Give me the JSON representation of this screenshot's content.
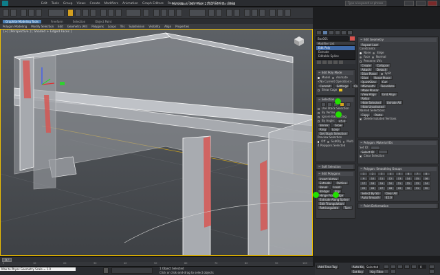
{
  "title_bar": {
    "window_title": "Autodesk 3ds Max 2012 x64     Untitled",
    "search_placeholder": "Type a keyword or phrase",
    "menus": [
      "Edit",
      "Tools",
      "Group",
      "Views",
      "Create",
      "Modifiers",
      "Animation",
      "Graph Editors",
      "Rendering",
      "Customize",
      "MAXScript",
      "Help"
    ]
  },
  "ribbon": {
    "tabs": [
      "Graphite Modeling Tools",
      "Freeform",
      "Selection",
      "Object Paint"
    ],
    "active_tab": 0,
    "subtabs": [
      "Polygon Modeling",
      "Modify Selection",
      "Edit",
      "Geometry (All)",
      "Polygons",
      "Loops",
      "Tris",
      "Subdivision",
      "Visibility",
      "Align",
      "Properties"
    ]
  },
  "viewport": {
    "label": "[+] [Perspective ] [ Shaded + Edged Faces ]",
    "border_color": "#f0c000",
    "highlight_color": "#d9534f"
  },
  "command_panel": {
    "object_name": "Box001",
    "modifier_list_label": "Modifier List",
    "stack": [
      "Edit Poly",
      "Extrude",
      "Editable Spline"
    ],
    "selected_stack_item": 0,
    "edit_poly_mode": {
      "header": "Edit Poly Mode",
      "model_label": "Model",
      "animate_label": "Animate",
      "current_op": "<No Current Operation>",
      "commit_label": "Commit",
      "settings_label": "Settings",
      "cancel_label": "Cancel",
      "show_cage_label": "Show Cage"
    },
    "selection": {
      "header": "Selection",
      "use_stack_label": "Use Stack Selection",
      "by_vertex_label": "By Vertex",
      "ignore_backfacing_label": "Ignore Backfacing",
      "by_angle_label": "By Angle:",
      "by_angle_value": "45.0",
      "shrink_label": "Shrink",
      "grow_label": "Grow",
      "ring_label": "Ring",
      "loop_label": "Loop",
      "get_stack_label": "Get Stack Selection",
      "preview_label": "Preview Selection",
      "off_label": "Off",
      "subobj_label": "SubObj",
      "multi_label": "Multi",
      "status": "4 Polygons Selected"
    },
    "soft_selection_header": "Soft Selection",
    "edit_polygons": {
      "header": "Edit Polygons",
      "insert_vertex_label": "Insert Vertex",
      "extrude_label": "Extrude",
      "outline_label": "Outline",
      "bevel_label": "Bevel",
      "inset_label": "Inset",
      "bridge_label": "Bridge",
      "flip_label": "Flip",
      "hinge_label": "Hinge From Edge",
      "extrude_spline_label": "Extrude Along Spline",
      "edit_tri_label": "Edit Triangulation",
      "retriangulate_label": "Retriangulate",
      "turn_label": "Turn"
    },
    "edit_geometry": {
      "header": "Edit Geometry",
      "repeat_last_label": "Repeat Last",
      "constraints_label": "Constraints",
      "none_label": "None",
      "edge_label": "Edge",
      "face_label": "Face",
      "normal_label": "Normal",
      "preserve_uvs_label": "Preserve UVs",
      "create_label": "Create",
      "collapse_label": "Collapse",
      "attach_label": "Attach",
      "detach_label": "Detach",
      "slice_plane_label": "Slice Plane",
      "split_label": "Split",
      "slice_label": "Slice",
      "reset_plane_label": "Reset Plane",
      "quickslice_label": "QuickSlice",
      "cut_label": "Cut",
      "msmooth_label": "MSmooth",
      "tessellate_label": "Tessellate",
      "make_planar_label": "Make Planar",
      "view_align_label": "View Align",
      "grid_align_label": "Grid Align",
      "relax_label": "Relax",
      "hide_selected_label": "Hide Selected",
      "unhide_all_label": "Unhide All",
      "hide_unselected_label": "Hide Unselected",
      "named_sel_label": "Named Selections:",
      "copy_label": "Copy",
      "paste_label": "Paste",
      "delete_isolated_label": "Delete Isolated Vertices"
    },
    "polygon_material_ids": {
      "header": "Polygon: Material IDs",
      "set_id_label": "Set ID:",
      "select_id_label": "Select ID",
      "clear_selection_label": "Clear Selection"
    },
    "smoothing_groups": {
      "header": "Polygon: Smoothing Groups",
      "numbers": [
        "1",
        "2",
        "3",
        "4",
        "5",
        "6",
        "7",
        "8",
        "9",
        "10",
        "11",
        "12",
        "13",
        "14",
        "15",
        "16",
        "17",
        "18",
        "19",
        "20",
        "21",
        "22",
        "23",
        "24",
        "25",
        "26",
        "27",
        "28",
        "29",
        "30",
        "31",
        "32"
      ],
      "select_by_sg_label": "Select By SG",
      "clear_all_label": "Clear All",
      "autosmooth_label": "Auto Smooth",
      "autosmooth_value": "45.0"
    },
    "paint_deformation_header": "Paint Deformation"
  },
  "time_slider": {
    "value": "0 / 100",
    "ticks": [
      "0",
      "10",
      "20",
      "30",
      "40",
      "50",
      "60",
      "70",
      "80",
      "90",
      "100"
    ]
  },
  "status_bar": {
    "maxscript": "Max to Physx Geometry Scale = 1.0",
    "prompt1": "1 Object Selected",
    "prompt2": "Click or click-and-drag to select objects",
    "add_time_tag": "Add Time Tag",
    "auto_key": "Auto Key",
    "set_key": "Set Key",
    "selected_dropdown": "Selected",
    "key_filters": "Key Filters...",
    "frame": "0"
  }
}
